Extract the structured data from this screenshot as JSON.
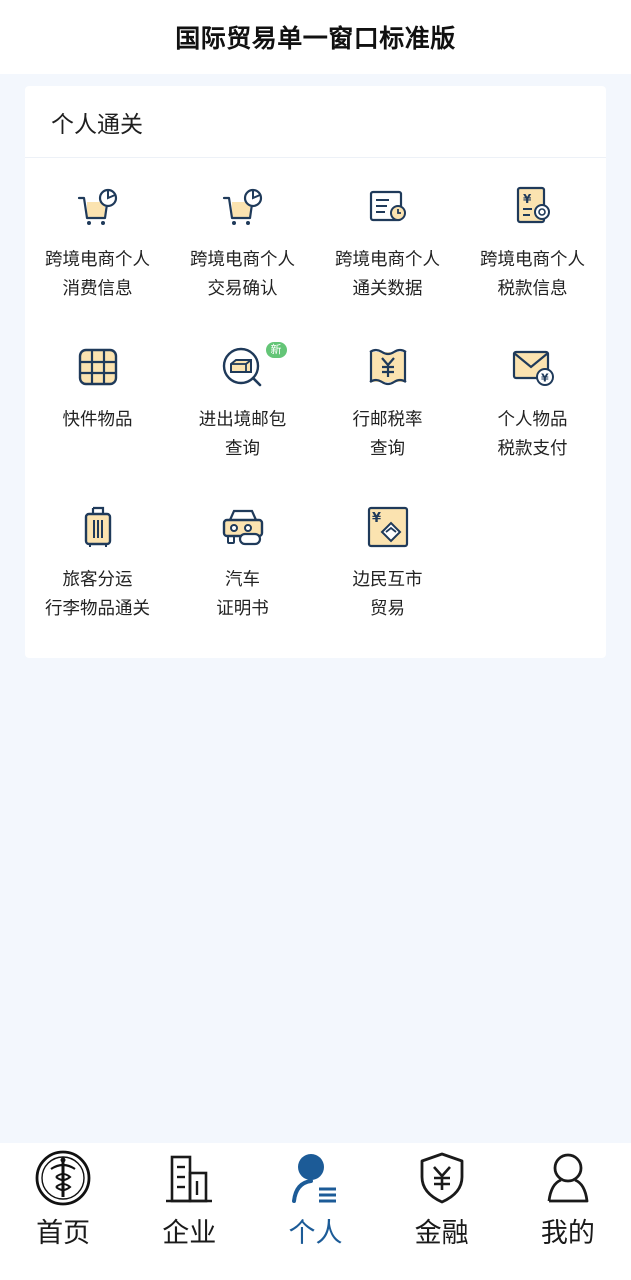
{
  "header": {
    "title": "国际贸易单一窗口标准版"
  },
  "section": {
    "title": "个人通关",
    "items": [
      {
        "line1": "跨境电商个人",
        "line2": "消费信息",
        "icon": "cart-chart-icon"
      },
      {
        "line1": "跨境电商个人",
        "line2": "交易确认",
        "icon": "cart-chart-icon"
      },
      {
        "line1": "跨境电商个人",
        "line2": "通关数据",
        "icon": "document-clock-icon"
      },
      {
        "line1": "跨境电商个人",
        "line2": "税款信息",
        "icon": "yuan-document-search-icon"
      },
      {
        "line1": "快件物品",
        "line2": "",
        "icon": "parcel-box-icon"
      },
      {
        "line1": "进出境邮包",
        "line2": "查询",
        "icon": "package-search-icon",
        "badge": "新"
      },
      {
        "line1": "行邮税率",
        "line2": "查询",
        "icon": "yuan-scroll-icon"
      },
      {
        "line1": "个人物品",
        "line2": "税款支付",
        "icon": "envelope-yuan-icon"
      },
      {
        "line1": "旅客分运",
        "line2": "行李物品通关",
        "icon": "luggage-icon"
      },
      {
        "line1": "汽车",
        "line2": "证明书",
        "icon": "car-certificate-icon"
      },
      {
        "line1": "边民互市",
        "line2": "贸易",
        "icon": "yuan-handshake-icon"
      }
    ]
  },
  "tabs": [
    {
      "label": "首页",
      "icon": "customs-emblem-icon",
      "active": false
    },
    {
      "label": "企业",
      "icon": "building-icon",
      "active": false
    },
    {
      "label": "个人",
      "icon": "person-list-icon",
      "active": true
    },
    {
      "label": "金融",
      "icon": "shield-yuan-icon",
      "active": false
    },
    {
      "label": "我的",
      "icon": "user-icon",
      "active": false
    }
  ],
  "colors": {
    "accent": "#1c5b97",
    "icon_stroke": "#1f3a5a",
    "icon_fill": "#fbe3b0",
    "badge": "#64c577",
    "background": "#f3f7fd"
  }
}
